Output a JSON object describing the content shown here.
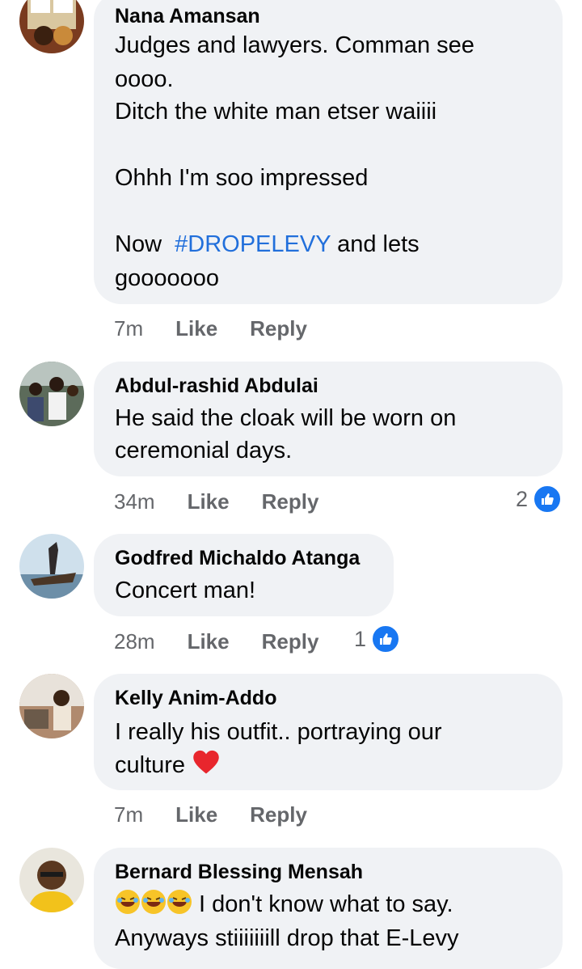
{
  "comments": [
    {
      "author": "Nana Amansan",
      "lines": [
        "Judges and lawyers. Comman see",
        "oooo.",
        "Ditch the white man etser waiiii",
        "",
        "Ohhh I'm soo impressed",
        "",
        "Now  ",
        "gooooooo"
      ],
      "hashtag": "#DROPELEVY",
      "hashtag_after": " and lets",
      "time": "7m",
      "like": "Like",
      "reply": "Reply"
    },
    {
      "author": "Abdul-rashid Abdulai",
      "lines": [
        "He said the cloak will be worn on",
        "ceremonial days."
      ],
      "time": "34m",
      "like": "Like",
      "reply": "Reply",
      "reactions": "2"
    },
    {
      "author": "Godfred Michaldo Atanga",
      "lines": [
        "Concert man!"
      ],
      "time": "28m",
      "like": "Like",
      "reply": "Reply",
      "reactions": "1"
    },
    {
      "author": "Kelly Anim-Addo",
      "lines": [
        "I really his outfit.. portraying our",
        "culture"
      ],
      "time": "7m",
      "like": "Like",
      "reply": "Reply"
    },
    {
      "author": "Bernard Blessing Mensah",
      "lines": [
        " I don't know what to say.",
        "Anyways stiiiiiiill drop that E-Levy"
      ],
      "time": "",
      "like": "",
      "reply": ""
    }
  ],
  "colors": {
    "bubble": "#f0f2f5",
    "hashtag": "#216fdb",
    "meta": "#65676b",
    "like_blue": "#1877f2",
    "heart": "#e8262d"
  }
}
